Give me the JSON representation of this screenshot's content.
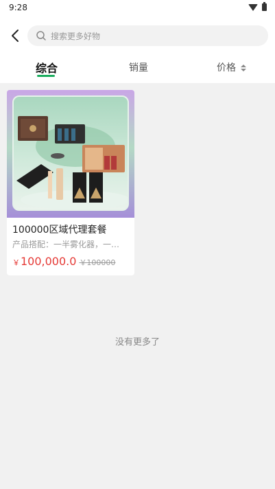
{
  "status_bar": {
    "time": "9:28",
    "icons": [
      "wifi-icon",
      "battery-icon"
    ]
  },
  "header": {
    "back_icon": "chevron-left-icon",
    "search": {
      "placeholder": "搜索更多好物",
      "icon": "search-icon"
    }
  },
  "sort_tabs": [
    {
      "label": "综合",
      "active": true
    },
    {
      "label": "销量",
      "active": false
    },
    {
      "label": "价格",
      "active": false,
      "icon": "sort-arrows-icon"
    }
  ],
  "accent_color": "#1aad5e",
  "price_color": "#e53935",
  "products": [
    {
      "title": "100000区域代理套餐",
      "description": "产品搭配：一半雾化器，一…",
      "currency": "￥",
      "price": "100,000.0",
      "original_price": "￥100000"
    }
  ],
  "footer": {
    "no_more_text": "没有更多了"
  }
}
